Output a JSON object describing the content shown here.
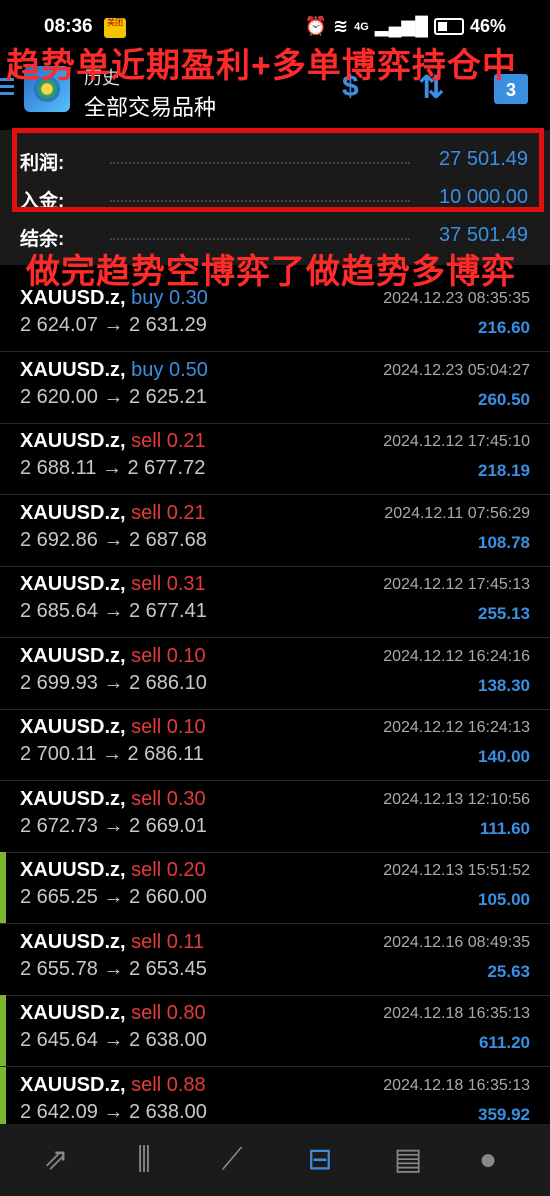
{
  "status": {
    "time": "08:36",
    "badge": "美团",
    "network": "4G",
    "battery": "46%"
  },
  "overlay": {
    "line1": "趋势单近期盈利+多单博弈持仓中",
    "line2": "做完趋势空博弈了做趋势多博弈"
  },
  "header": {
    "title": "历史",
    "subtitle": "全部交易品种",
    "calendar_day": "3"
  },
  "summary": {
    "profit_label": "利润:",
    "profit_value": "27 501.49",
    "deposit_label": "入金:",
    "deposit_value": "10 000.00",
    "balance_label": "结余:",
    "balance_value": "37 501.49"
  },
  "trades": [
    {
      "symbol": "XAUUSD.z,",
      "side": "buy 0.30",
      "open": "2 624.07",
      "close": "2 631.29",
      "time": "2024.12.23 08:35:35",
      "profit": "216.60"
    },
    {
      "symbol": "XAUUSD.z,",
      "side": "buy 0.50",
      "open": "2 620.00",
      "close": "2 625.21",
      "time": "2024.12.23 05:04:27",
      "profit": "260.50"
    },
    {
      "symbol": "XAUUSD.z,",
      "side": "sell 0.21",
      "open": "2 688.11",
      "close": "2 677.72",
      "time": "2024.12.12 17:45:10",
      "profit": "218.19"
    },
    {
      "symbol": "XAUUSD.z,",
      "side": "sell 0.21",
      "open": "2 692.86",
      "close": "2 687.68",
      "time": "2024.12.11 07:56:29",
      "profit": "108.78"
    },
    {
      "symbol": "XAUUSD.z,",
      "side": "sell 0.31",
      "open": "2 685.64",
      "close": "2 677.41",
      "time": "2024.12.12 17:45:13",
      "profit": "255.13"
    },
    {
      "symbol": "XAUUSD.z,",
      "side": "sell 0.10",
      "open": "2 699.93",
      "close": "2 686.10",
      "time": "2024.12.12 16:24:16",
      "profit": "138.30"
    },
    {
      "symbol": "XAUUSD.z,",
      "side": "sell 0.10",
      "open": "2 700.11",
      "close": "2 686.11",
      "time": "2024.12.12 16:24:13",
      "profit": "140.00"
    },
    {
      "symbol": "XAUUSD.z,",
      "side": "sell 0.30",
      "open": "2 672.73",
      "close": "2 669.01",
      "time": "2024.12.13 12:10:56",
      "profit": "111.60"
    },
    {
      "symbol": "XAUUSD.z,",
      "side": "sell 0.20",
      "open": "2 665.25",
      "close": "2 660.00",
      "time": "2024.12.13 15:51:52",
      "profit": "105.00"
    },
    {
      "symbol": "XAUUSD.z,",
      "side": "sell 0.11",
      "open": "2 655.78",
      "close": "2 653.45",
      "time": "2024.12.16 08:49:35",
      "profit": "25.63"
    },
    {
      "symbol": "XAUUSD.z,",
      "side": "sell 0.80",
      "open": "2 645.64",
      "close": "2 638.00",
      "time": "2024.12.18 16:35:13",
      "profit": "611.20"
    },
    {
      "symbol": "XAUUSD.z,",
      "side": "sell 0.88",
      "open": "2 642.09",
      "close": "2 638.00",
      "time": "2024.12.18 16:35:13",
      "profit": "359.92"
    }
  ],
  "arrow": "→",
  "colors": {
    "accent": "#3b8fe0",
    "sell": "#e23b3b",
    "highlight": "#e01010"
  },
  "nav": [
    {
      "icon": "trade-icon"
    },
    {
      "icon": "chart-candles-icon"
    },
    {
      "icon": "trend-icon"
    },
    {
      "icon": "history-inbox-icon",
      "active": true
    },
    {
      "icon": "news-icon"
    },
    {
      "icon": "chat-icon"
    }
  ]
}
